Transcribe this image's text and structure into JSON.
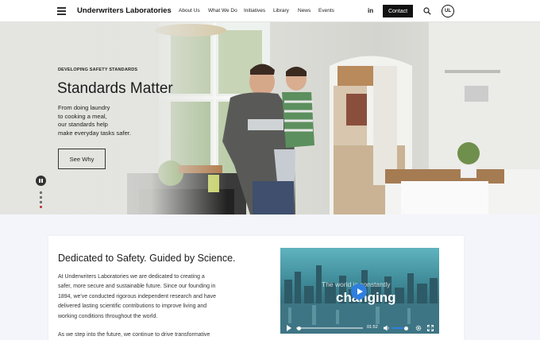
{
  "header": {
    "brand": "Underwriters Laboratories",
    "nav": [
      "About Us",
      "What We Do",
      "Initiatives",
      "Library",
      "News",
      "Events"
    ],
    "linkedin": "in",
    "contact_label": "Contact",
    "logo_text": "UL"
  },
  "hero": {
    "eyebrow": "DEVELOPING SAFETY STANDARDS",
    "title": "Standards Matter",
    "text_lines": [
      "From doing laundry",
      "to cooking a meal,",
      "our standards help",
      "make everyday tasks safer."
    ],
    "cta_label": "See Why",
    "slides": {
      "count": 4,
      "active": 4
    }
  },
  "intro": {
    "title": "Dedicated to Safety. Guided by Science.",
    "body_lines": [
      "At Underwriters Laboratories we are dedicated to creating a",
      "safer, more secure and sustainable future. Since our founding in",
      "1894, we've conducted rigorous independent research and have",
      "delivered lasting scientific contributions to improve living and",
      "working conditions throughout the world."
    ],
    "body2": "As we step into the future, we continue to drive transformative"
  },
  "video": {
    "caption_top": "The world is constantly",
    "caption_big": "changing",
    "time": "01:52",
    "progress": 0.03,
    "volume": 0.8
  },
  "colors": {
    "accent_red": "#c0282d",
    "play_blue": "#2f7fe0",
    "contact_bg": "#111111"
  }
}
